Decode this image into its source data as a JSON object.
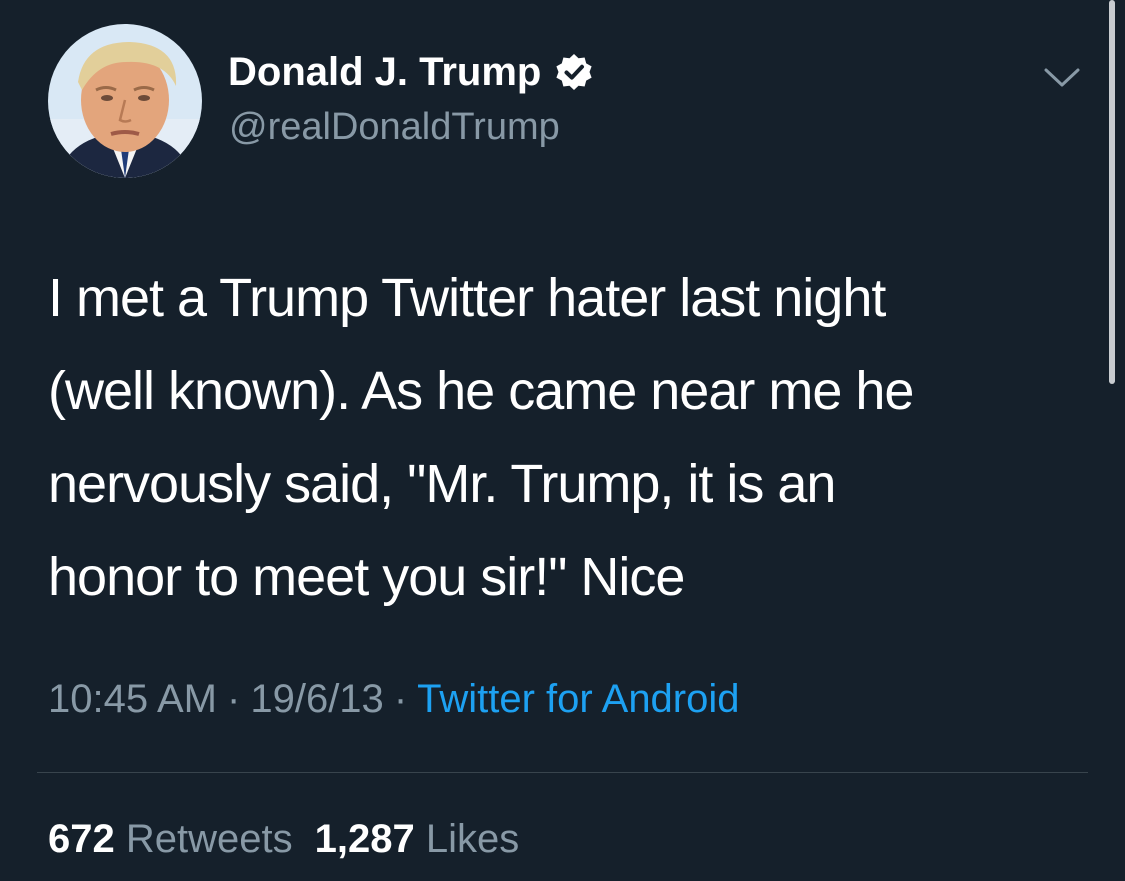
{
  "tweet": {
    "author": {
      "display_name": "Donald J. Trump",
      "handle": "@realDonaldTrump",
      "verified": true,
      "avatar": "profile-photo"
    },
    "text_lines": [
      "I met a Trump Twitter hater last night",
      "(well known). As he came near me he",
      "nervously said, \"Mr. Trump, it is an",
      "honor to meet you sir!\" Nice"
    ],
    "time": "10:45 AM",
    "date": "19/6/13",
    "separator": "·",
    "source": "Twitter for Android",
    "stats": {
      "retweets_count": "672",
      "retweets_label": "Retweets",
      "likes_count": "1,287",
      "likes_label": "Likes"
    }
  },
  "icons": {
    "verified": "verified-badge-icon",
    "more": "chevron-down-icon"
  },
  "colors": {
    "background": "#15202b",
    "primary_text": "#ffffff",
    "secondary_text": "#8899a6",
    "accent": "#1da1f2",
    "divider": "#38444d"
  }
}
